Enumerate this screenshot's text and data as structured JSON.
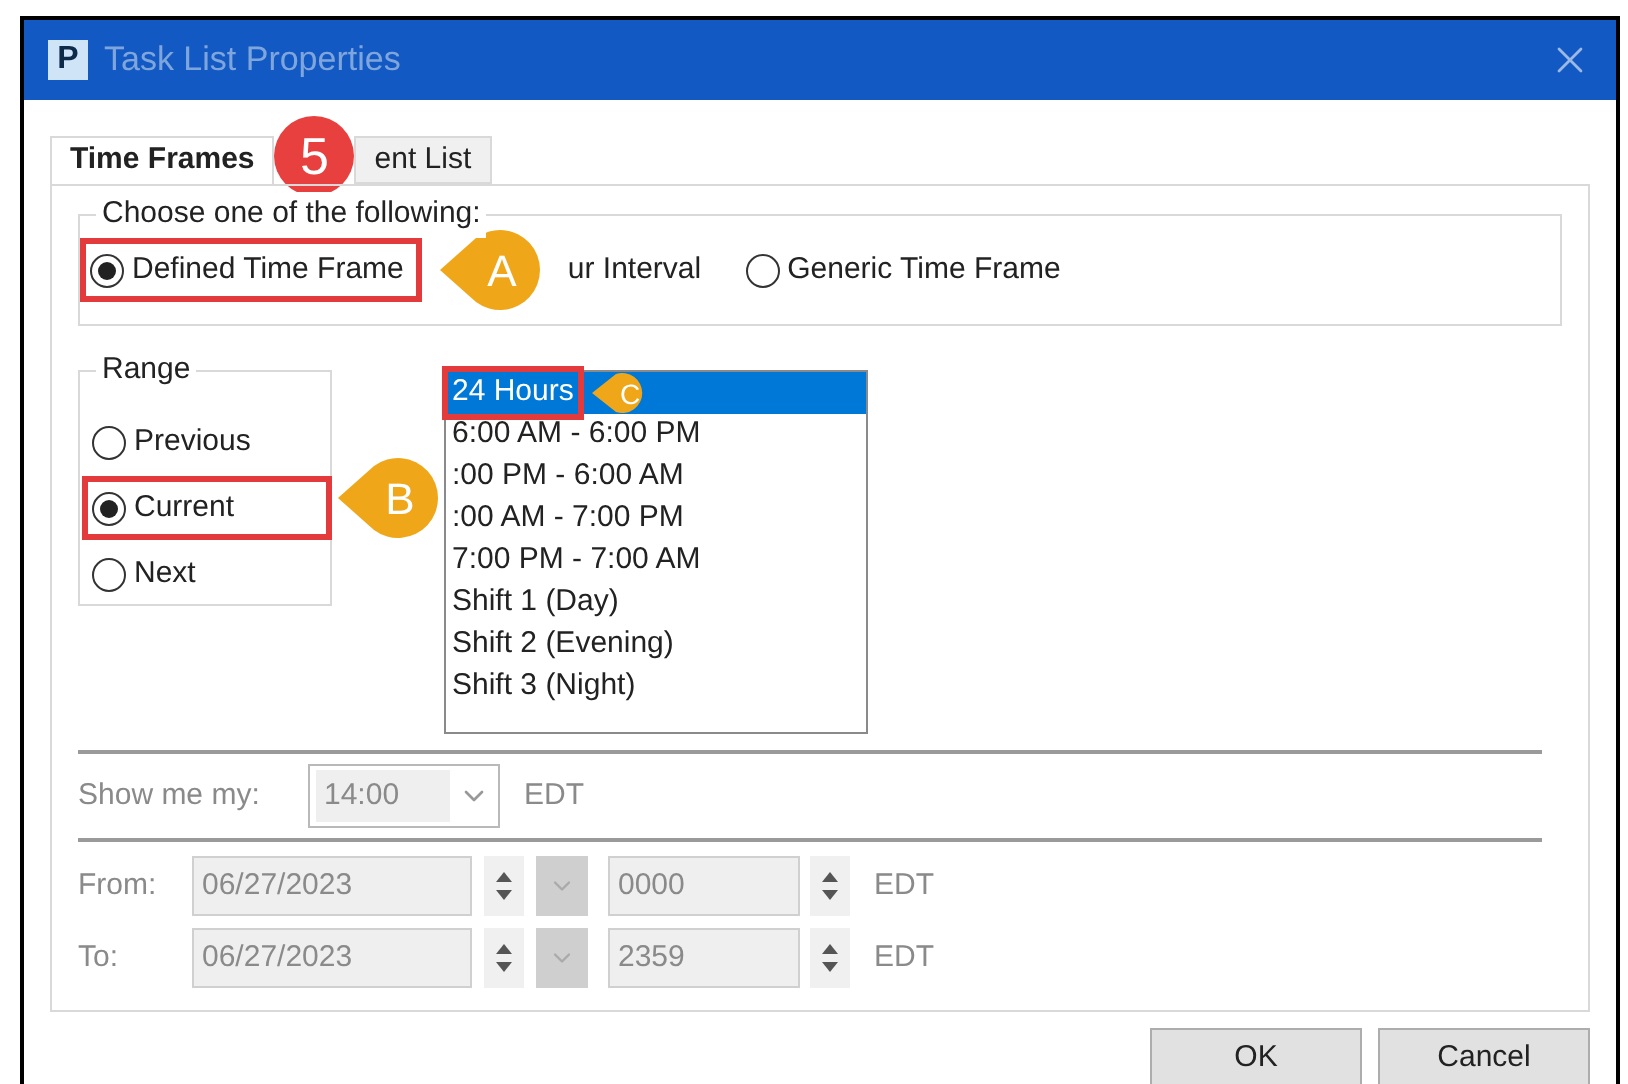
{
  "window": {
    "title": "Task List Properties",
    "logo": "P"
  },
  "tabs": [
    {
      "label": "Time Frames",
      "selected": true,
      "callout": "5"
    },
    {
      "label": "ent List",
      "selected": false
    }
  ],
  "choose": {
    "legend": "Choose one of the following:",
    "options": [
      {
        "label": "Defined Time Frame",
        "selected": true,
        "highlighted": true,
        "callout": "A"
      },
      {
        "label": "ur Interval",
        "selected": false,
        "partial": true
      },
      {
        "label": "Generic Time Frame",
        "selected": false
      }
    ]
  },
  "range": {
    "legend": "Range",
    "options": [
      {
        "label": "Previous",
        "selected": false,
        "highlighted": false
      },
      {
        "label": "Current",
        "selected": true,
        "highlighted": true,
        "callout": "B"
      },
      {
        "label": "Next",
        "selected": false,
        "highlighted": false
      }
    ]
  },
  "time_frames": [
    {
      "label": "24 Hours",
      "selected": true,
      "highlighted": true,
      "callout": "C"
    },
    {
      "label": "6:00 AM - 6:00 PM",
      "selected": false
    },
    {
      "label": ":00 PM - 6:00 AM",
      "selected": false
    },
    {
      "label": ":00 AM - 7:00 PM",
      "selected": false
    },
    {
      "label": "7:00 PM - 7:00 AM",
      "selected": false
    },
    {
      "label": "Shift 1 (Day)",
      "selected": false
    },
    {
      "label": "Shift 2 (Evening)",
      "selected": false
    },
    {
      "label": "Shift 3 (Night)",
      "selected": false
    }
  ],
  "show_me": {
    "label": "Show me my:",
    "value": "14:00",
    "zone": "EDT",
    "disabled": true
  },
  "from": {
    "label": "From:",
    "date": "06/27/2023",
    "time": "0000",
    "zone": "EDT",
    "disabled": true
  },
  "to": {
    "label": "To:",
    "date": "06/27/2023",
    "time": "2359",
    "zone": "EDT",
    "disabled": true
  },
  "buttons": [
    "OK",
    "Cancel"
  ]
}
